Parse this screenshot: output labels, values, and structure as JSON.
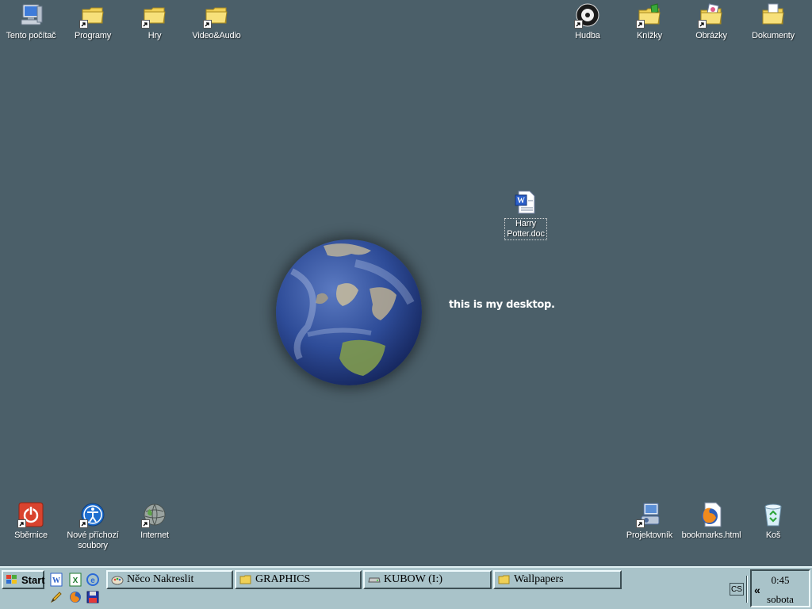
{
  "desktop": {
    "background_color": "#4b5f69",
    "caption": "this is my desktop.",
    "icons_top_left": [
      {
        "label": "Tento počítač",
        "icon": "computer-icon"
      },
      {
        "label": "Programy",
        "icon": "folder-shortcut-icon"
      },
      {
        "label": "Hry",
        "icon": "folder-shortcut-icon"
      },
      {
        "label": "Video&Audio",
        "icon": "folder-shortcut-icon"
      }
    ],
    "icons_top_right": [
      {
        "label": "Hudba",
        "icon": "music-cd-icon"
      },
      {
        "label": "Knížky",
        "icon": "books-folder-icon"
      },
      {
        "label": "Obrázky",
        "icon": "pictures-folder-icon"
      },
      {
        "label": "Dokumenty",
        "icon": "documents-folder-icon"
      }
    ],
    "selected_file": {
      "label_line1": "Harry",
      "label_line2": "Potter.doc",
      "icon": "word-document-icon"
    },
    "icons_bottom_left": [
      {
        "label": "Sběrnice",
        "icon": "power-icon"
      },
      {
        "label_line1": "Nové příchozí",
        "label_line2": "soubory",
        "icon": "accessibility-icon"
      },
      {
        "label": "Internet",
        "icon": "globe-icon"
      }
    ],
    "icons_bottom_right": [
      {
        "label": "Projektovník",
        "icon": "projector-icon"
      },
      {
        "label": "bookmarks.html",
        "icon": "firefox-html-icon"
      },
      {
        "label": "Koš",
        "icon": "recycle-bin-icon"
      }
    ]
  },
  "taskbar": {
    "start_label": "Start",
    "buttons": [
      {
        "label": "Něco Nakreslit",
        "icon": "paint-icon"
      },
      {
        "label": "GRAPHICS",
        "icon": "folder-icon"
      },
      {
        "label": "KUBOW (I:)",
        "icon": "drive-icon"
      },
      {
        "label": "Wallpapers",
        "icon": "folder-icon"
      }
    ],
    "quick_launch": [
      "word-icon",
      "excel-icon",
      "ie-icon",
      "pencil-icon",
      "firefox-icon",
      "floppy-icon"
    ],
    "tray": {
      "language": "CS",
      "expand": "«",
      "time": "0:45",
      "day": "sobota"
    }
  }
}
